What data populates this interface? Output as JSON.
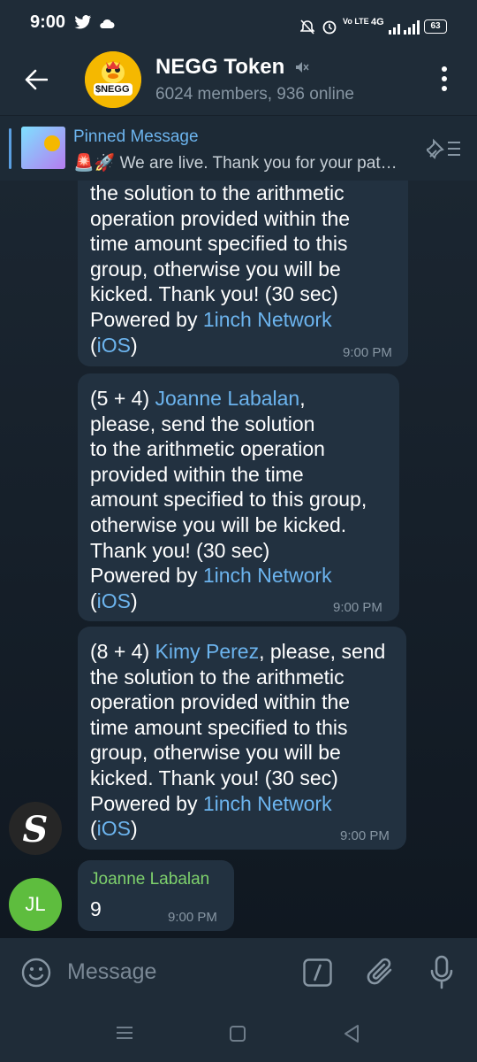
{
  "status": {
    "time": "9:00",
    "battery": "63",
    "net": "4G",
    "lte": "Vo LTE"
  },
  "chat": {
    "title": "NEGG Token",
    "subtitle": "6024 members, 936 online",
    "avatar_text": "$NEGG"
  },
  "pinned": {
    "label": "Pinned Message",
    "text": "🚨🚀 We are live. Thank you for your pat…"
  },
  "messages": [
    {
      "lines_before": "the solution to the arithmetic\noperation provided within the\ntime amount specified to this\ngroup, otherwise you will be\nkicked. Thank you! (30 sec)\nPowered by ",
      "link1": "1inch Network",
      "paren_open": "(",
      "link2": "iOS",
      "paren_close": ")",
      "time": "9:00 PM"
    },
    {
      "prefix": "(5 + 4) ",
      "mention": "Joanne Labalan",
      "body": ",\nplease, send the solution\nto the arithmetic operation\nprovided within the time\namount specified to this group,\notherwise you will be kicked.\nThank you! (30 sec)\nPowered by ",
      "link1": "1inch Network",
      "paren_open": "(",
      "link2": "iOS",
      "paren_close": ")",
      "time": "9:00 PM"
    },
    {
      "prefix": "(8 + 4) ",
      "mention": "Kimy Perez",
      "body": ", please, send\nthe solution to the arithmetic\noperation provided within the\ntime amount specified to this\ngroup, otherwise you will be\nkicked. Thank you! (30 sec)\nPowered by ",
      "link1": "1inch Network",
      "paren_open": "(",
      "link2": "iOS",
      "paren_close": ")",
      "time": "9:00 PM",
      "sender_avatar": "S"
    },
    {
      "sender": "Joanne Labalan",
      "text": "9",
      "time": "9:00 PM",
      "avatar": "JL"
    }
  ],
  "input": {
    "placeholder": "Message"
  },
  "colors": {
    "link": "#6cb4ee",
    "sender_green": "#7ed16c",
    "avatar_green": "#5ebd3e"
  }
}
